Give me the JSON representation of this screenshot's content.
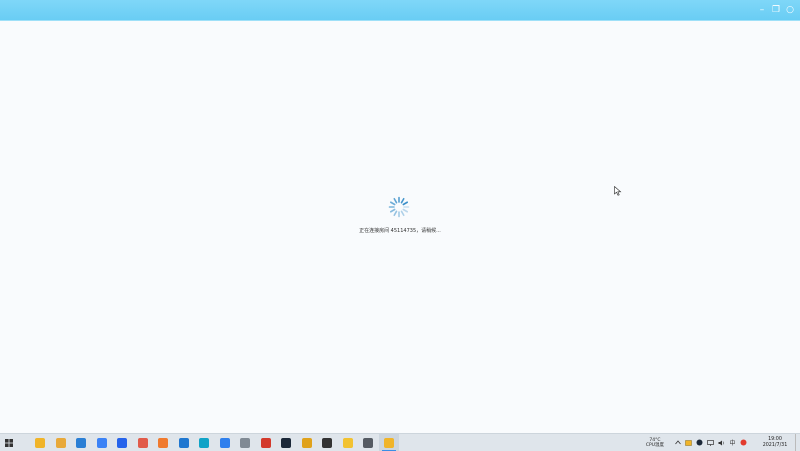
{
  "window": {
    "controls": {
      "minimize": "–",
      "maximize": "❐",
      "close": "○"
    }
  },
  "main": {
    "loading_text": "正在连接房间 45114735，请稍候..."
  },
  "taskbar": {
    "apps": [
      {
        "icon": "file-explorer-icon",
        "color": "#f0b429",
        "active": false
      },
      {
        "icon": "file-manager-icon",
        "color": "#e8a93a",
        "active": false
      },
      {
        "icon": "edge-icon",
        "color": "#2a7fd5",
        "active": false
      },
      {
        "icon": "browser-icon",
        "color": "#3b82f6",
        "active": false
      },
      {
        "icon": "shield-icon",
        "color": "#2563eb",
        "active": false
      },
      {
        "icon": "cloud-icon",
        "color": "#e15b4a",
        "active": false
      },
      {
        "icon": "app-orange-icon",
        "color": "#f07a2e",
        "active": false
      },
      {
        "icon": "mail-icon",
        "color": "#1f77d0",
        "active": false
      },
      {
        "icon": "edge-browser-icon",
        "color": "#10a3c7",
        "active": false
      },
      {
        "icon": "vs-code-icon",
        "color": "#2f80ed",
        "active": false
      },
      {
        "icon": "printer-icon",
        "color": "#808a94",
        "active": false
      },
      {
        "icon": "media-app-icon",
        "color": "#d33a2c",
        "active": false
      },
      {
        "icon": "steam-icon",
        "color": "#1b2838",
        "active": false
      },
      {
        "icon": "chrome-icon",
        "color": "#e0a21b",
        "active": false
      },
      {
        "icon": "clock-app-icon",
        "color": "#333333",
        "active": false
      },
      {
        "icon": "chat-app-icon",
        "color": "#f2c230",
        "active": false
      },
      {
        "icon": "phone-link-icon",
        "color": "#555b63",
        "active": false
      },
      {
        "icon": "movie-app-icon",
        "color": "#f0b429",
        "active": true
      }
    ],
    "tray": {
      "cpu_temp": "74°C",
      "cpu_label": "CPU温度",
      "ime": "中",
      "time": "19:00",
      "date": "2021/7/31"
    }
  }
}
